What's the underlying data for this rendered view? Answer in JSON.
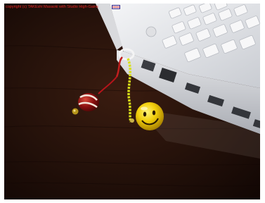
{
  "caption": {
    "text": "copyright (c) TAKEshi Masaoki with Studio High-Gains",
    "color": "#e02323"
  },
  "scene": {
    "background_color": "#1e0d07",
    "laptop_color": "#ecedef",
    "bell_color": "#f2cf0c",
    "cord_color": "#d8e018",
    "bead_color": "#8a1010"
  }
}
